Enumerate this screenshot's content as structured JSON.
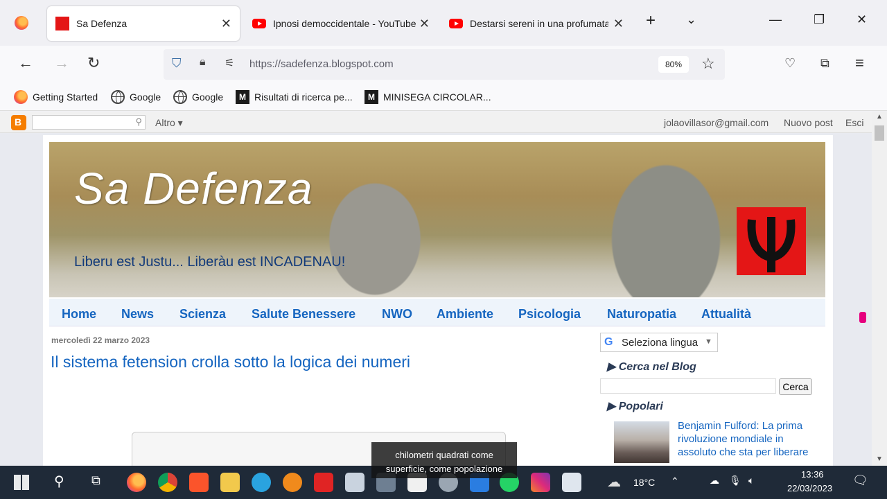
{
  "browser": {
    "tabs": [
      {
        "label": "Sa Defenza",
        "active": true
      },
      {
        "label": "Ipnosi democcidentale - YouTube",
        "active": false
      },
      {
        "label": "Destarsi sereni in una profumata",
        "active": false
      }
    ],
    "new_tab_icon": "plus-icon",
    "url": "https://sadefenza.blogspot.com",
    "zoom": "80%",
    "bookmarks": [
      {
        "label": "Getting Started",
        "icon": "firefox-icon"
      },
      {
        "label": "Google",
        "icon": "globe-icon"
      },
      {
        "label": "Google",
        "icon": "globe-icon"
      },
      {
        "label": "Risultati di ricerca pe...",
        "icon": "m-logo-icon"
      },
      {
        "label": "MINISEGA CIRCOLAR...",
        "icon": "m-logo-icon"
      }
    ]
  },
  "blogger_bar": {
    "altro": "Altro",
    "email": "jolaovillasor@gmail.com",
    "new_post": "Nuovo post",
    "exit": "Esci"
  },
  "blog": {
    "title": "Sa Defenza",
    "tagline": "Liberu est Justu... Liberàu est INCADENAU!",
    "menu": [
      "Home",
      "News",
      "Scienza",
      "Salute Benessere",
      "NWO",
      "Ambiente",
      "Psicologia",
      "Naturopatia",
      "Attualità"
    ],
    "post_date": "mercoledì 22 marzo 2023",
    "post_title": "Il sistema fetension crolla sotto la logica dei numeri"
  },
  "sidebar": {
    "translate": "Seleziona lingua",
    "search_heading": "Cerca nel Blog",
    "search_button": "Cerca",
    "popular_heading": "Popolari",
    "popular_post": "Benjamin Fulford: La prima rivoluzione mondiale in assoluto che sta per liberare"
  },
  "caption": {
    "line1": "chilometri quadrati come",
    "line2": "superficie, come popolazione"
  },
  "taskbar": {
    "temperature": "18°C",
    "time": "13:36",
    "date": "22/03/2023"
  },
  "colors": {
    "link_blue": "#1565c0",
    "taskbar": "#1f2a38",
    "logo_red": "#e41616"
  }
}
